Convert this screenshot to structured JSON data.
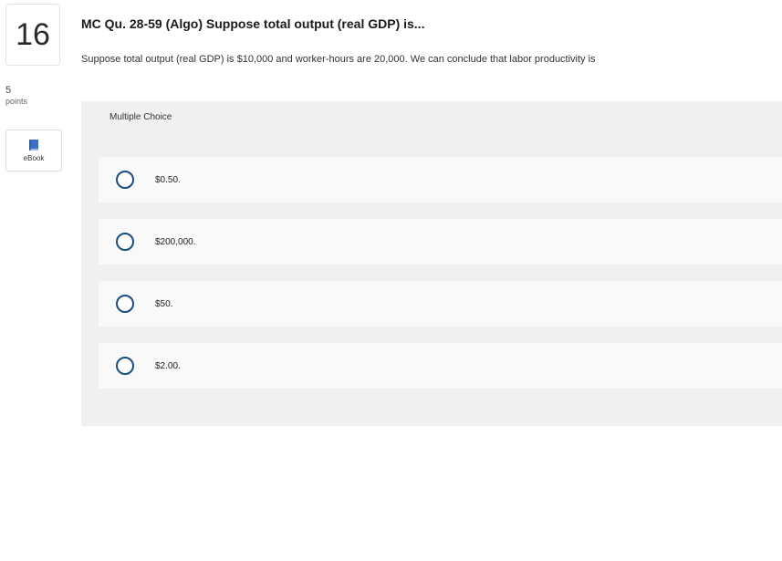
{
  "question": {
    "number": "16",
    "points_value": "5",
    "points_label": "points",
    "title": "MC Qu. 28-59 (Algo) Suppose total output (real GDP) is...",
    "stem": "Suppose total output (real GDP) is $10,000 and worker-hours are 20,000. We can conclude that labor productivity is"
  },
  "ebook": {
    "label": "eBook",
    "icon": "book-icon"
  },
  "multiple_choice": {
    "header": "Multiple Choice",
    "options": [
      {
        "label": "$0.50."
      },
      {
        "label": "$200,000."
      },
      {
        "label": "$50."
      },
      {
        "label": "$2.00."
      }
    ]
  },
  "colors": {
    "radio_border": "#1b4c80",
    "panel_bg": "#f0f0f0",
    "option_bg": "#f9f9f9",
    "book_icon": "#3a6fc4"
  }
}
